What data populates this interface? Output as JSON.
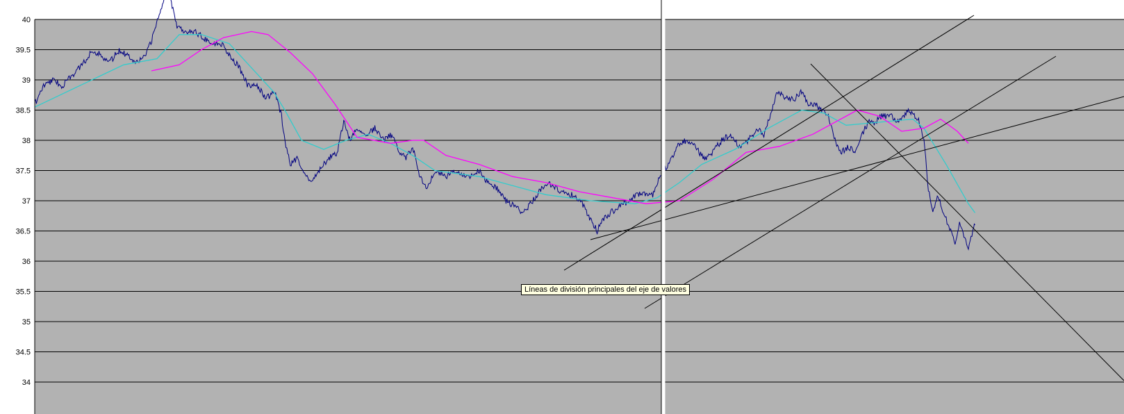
{
  "colors": {
    "plot_bg": "#b2b2b2",
    "grid": "#000000",
    "price": "#000080",
    "ma_short": "#33cccc",
    "ma_long": "#ff00ff",
    "trendline": "#000000",
    "tooltip_bg": "#ffffe1"
  },
  "tooltip": {
    "text": "Líneas de división principales del eje de valores"
  },
  "chart_data": {
    "type": "line",
    "ylim": [
      33.5,
      40
    ],
    "grid": true,
    "y_ticks": [
      "40",
      "39.5",
      "39",
      "38.5",
      "38",
      "37.5",
      "37",
      "36.5",
      "36",
      "35.5",
      "35",
      "34.5",
      "34"
    ],
    "x_index_range": [
      0,
      1000
    ],
    "series": [
      {
        "role": "price",
        "color": "#000080",
        "points": [
          [
            0,
            38.6
          ],
          [
            8,
            38.9
          ],
          [
            16,
            39.0
          ],
          [
            25,
            38.9
          ],
          [
            35,
            39.1
          ],
          [
            45,
            39.3
          ],
          [
            52,
            39.5
          ],
          [
            60,
            39.4
          ],
          [
            68,
            39.3
          ],
          [
            76,
            39.5
          ],
          [
            84,
            39.4
          ],
          [
            92,
            39.3
          ],
          [
            100,
            39.4
          ],
          [
            106,
            39.7
          ],
          [
            112,
            40.1
          ],
          [
            120,
            40.5
          ],
          [
            128,
            39.9
          ],
          [
            136,
            39.8
          ],
          [
            144,
            39.8
          ],
          [
            152,
            39.7
          ],
          [
            160,
            39.6
          ],
          [
            168,
            39.6
          ],
          [
            176,
            39.4
          ],
          [
            184,
            39.2
          ],
          [
            192,
            38.9
          ],
          [
            200,
            38.9
          ],
          [
            208,
            38.7
          ],
          [
            216,
            38.8
          ],
          [
            222,
            38.4
          ],
          [
            226,
            37.9
          ],
          [
            230,
            37.6
          ],
          [
            236,
            37.7
          ],
          [
            242,
            37.5
          ],
          [
            248,
            37.3
          ],
          [
            256,
            37.5
          ],
          [
            264,
            37.7
          ],
          [
            272,
            37.8
          ],
          [
            278,
            38.3
          ],
          [
            284,
            38.0
          ],
          [
            290,
            38.2
          ],
          [
            298,
            38.1
          ],
          [
            306,
            38.2
          ],
          [
            314,
            38.0
          ],
          [
            322,
            38.1
          ],
          [
            328,
            37.8
          ],
          [
            334,
            37.7
          ],
          [
            340,
            37.9
          ],
          [
            346,
            37.4
          ],
          [
            352,
            37.2
          ],
          [
            360,
            37.5
          ],
          [
            370,
            37.4
          ],
          [
            380,
            37.5
          ],
          [
            390,
            37.4
          ],
          [
            400,
            37.5
          ],
          [
            408,
            37.3
          ],
          [
            416,
            37.2
          ],
          [
            424,
            37.0
          ],
          [
            432,
            36.9
          ],
          [
            440,
            36.8
          ],
          [
            448,
            37.0
          ],
          [
            456,
            37.2
          ],
          [
            462,
            37.3
          ],
          [
            470,
            37.2
          ],
          [
            478,
            37.1
          ],
          [
            486,
            37.1
          ],
          [
            494,
            36.9
          ],
          [
            500,
            36.7
          ],
          [
            506,
            36.5
          ],
          [
            512,
            36.7
          ],
          [
            518,
            36.8
          ],
          [
            526,
            36.9
          ],
          [
            534,
            37.0
          ],
          [
            542,
            37.1
          ],
          [
            550,
            37.1
          ],
          [
            556,
            37.1
          ],
          [
            562,
            37.4
          ],
          [
            570,
            37.6
          ],
          [
            578,
            37.9
          ],
          [
            586,
            38.0
          ],
          [
            594,
            37.9
          ],
          [
            602,
            37.7
          ],
          [
            610,
            37.8
          ],
          [
            618,
            38.0
          ],
          [
            626,
            38.1
          ],
          [
            634,
            37.9
          ],
          [
            642,
            38.0
          ],
          [
            650,
            38.2
          ],
          [
            656,
            38.1
          ],
          [
            662,
            38.4
          ],
          [
            668,
            38.8
          ],
          [
            676,
            38.7
          ],
          [
            684,
            38.7
          ],
          [
            690,
            38.8
          ],
          [
            696,
            38.6
          ],
          [
            702,
            38.6
          ],
          [
            708,
            38.5
          ],
          [
            714,
            38.4
          ],
          [
            720,
            38.0
          ],
          [
            726,
            37.8
          ],
          [
            732,
            37.9
          ],
          [
            738,
            37.8
          ],
          [
            744,
            38.1
          ],
          [
            750,
            38.3
          ],
          [
            756,
            38.3
          ],
          [
            762,
            38.4
          ],
          [
            770,
            38.4
          ],
          [
            778,
            38.3
          ],
          [
            786,
            38.5
          ],
          [
            792,
            38.4
          ],
          [
            796,
            38.3
          ],
          [
            800,
            38.0
          ],
          [
            804,
            37.2
          ],
          [
            808,
            36.8
          ],
          [
            812,
            37.1
          ],
          [
            816,
            36.9
          ],
          [
            820,
            36.7
          ],
          [
            824,
            36.5
          ],
          [
            828,
            36.3
          ],
          [
            832,
            36.6
          ],
          [
            836,
            36.4
          ],
          [
            840,
            36.2
          ],
          [
            844,
            36.5
          ],
          [
            846,
            36.6
          ]
        ]
      },
      {
        "role": "moving-average-short",
        "color": "#33cccc",
        "points": [
          [
            0,
            38.55
          ],
          [
            40,
            38.9
          ],
          [
            80,
            39.25
          ],
          [
            110,
            39.35
          ],
          [
            130,
            39.75
          ],
          [
            150,
            39.75
          ],
          [
            175,
            39.6
          ],
          [
            200,
            39.1
          ],
          [
            215,
            38.8
          ],
          [
            225,
            38.5
          ],
          [
            240,
            38.0
          ],
          [
            260,
            37.85
          ],
          [
            280,
            38.0
          ],
          [
            300,
            38.1
          ],
          [
            320,
            37.95
          ],
          [
            340,
            37.75
          ],
          [
            360,
            37.5
          ],
          [
            400,
            37.4
          ],
          [
            430,
            37.25
          ],
          [
            460,
            37.1
          ],
          [
            500,
            37.0
          ],
          [
            540,
            36.95
          ],
          [
            560,
            37.05
          ],
          [
            580,
            37.3
          ],
          [
            600,
            37.6
          ],
          [
            630,
            37.85
          ],
          [
            660,
            38.2
          ],
          [
            690,
            38.5
          ],
          [
            710,
            38.45
          ],
          [
            730,
            38.25
          ],
          [
            760,
            38.3
          ],
          [
            790,
            38.35
          ],
          [
            800,
            38.2
          ],
          [
            820,
            37.6
          ],
          [
            840,
            36.95
          ],
          [
            846,
            36.8
          ]
        ]
      },
      {
        "role": "moving-average-long",
        "color": "#ff00ff",
        "points": [
          [
            105,
            39.15
          ],
          [
            130,
            39.25
          ],
          [
            150,
            39.5
          ],
          [
            170,
            39.7
          ],
          [
            195,
            39.8
          ],
          [
            210,
            39.75
          ],
          [
            230,
            39.45
          ],
          [
            250,
            39.1
          ],
          [
            270,
            38.6
          ],
          [
            290,
            38.05
          ],
          [
            320,
            37.95
          ],
          [
            340,
            38.0
          ],
          [
            350,
            38.0
          ],
          [
            370,
            37.75
          ],
          [
            400,
            37.6
          ],
          [
            430,
            37.4
          ],
          [
            460,
            37.3
          ],
          [
            490,
            37.15
          ],
          [
            520,
            37.05
          ],
          [
            550,
            36.95
          ],
          [
            580,
            37.0
          ],
          [
            610,
            37.35
          ],
          [
            640,
            37.8
          ],
          [
            670,
            37.9
          ],
          [
            700,
            38.1
          ],
          [
            720,
            38.3
          ],
          [
            740,
            38.5
          ],
          [
            760,
            38.4
          ],
          [
            780,
            38.15
          ],
          [
            800,
            38.2
          ],
          [
            815,
            38.35
          ],
          [
            830,
            38.15
          ],
          [
            840,
            37.95
          ]
        ]
      }
    ]
  }
}
